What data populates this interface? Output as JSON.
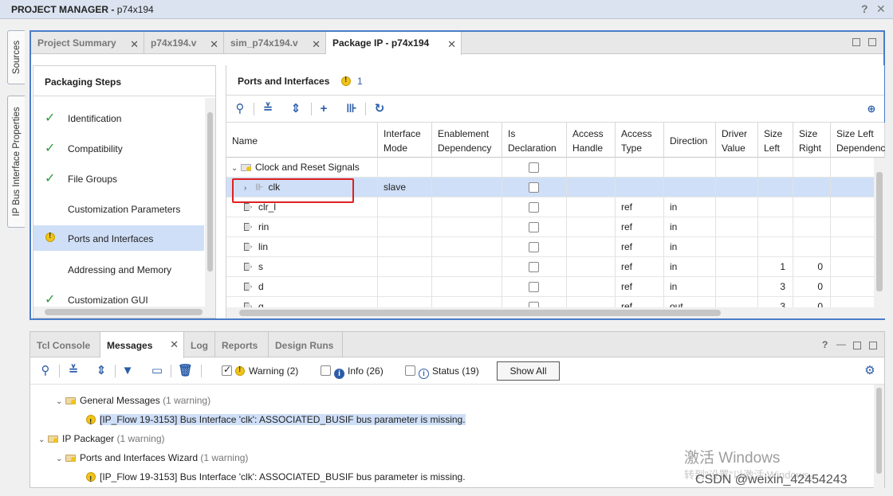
{
  "title_bar": {
    "label": "PROJECT MANAGER",
    "project": "p74x194",
    "help": "?",
    "close": "✕"
  },
  "side_tabs": [
    "Sources",
    "IP Bus Interface Properties"
  ],
  "editor_tabs": [
    {
      "label": "Project Summary",
      "close": "✕"
    },
    {
      "label": "p74x194.v",
      "close": "✕"
    },
    {
      "label": "sim_p74x194.v",
      "close": "✕"
    },
    {
      "label": "Package IP - p74x194",
      "close": "✕"
    }
  ],
  "steps": {
    "header": "Packaging Steps",
    "items": [
      {
        "label": "Identification",
        "status": "✓"
      },
      {
        "label": "Compatibility",
        "status": "✓"
      },
      {
        "label": "File Groups",
        "status": "✓"
      },
      {
        "label": "Customization Parameters",
        "status": ""
      },
      {
        "label": "Ports and Interfaces",
        "status": "warning"
      },
      {
        "label": "Addressing and Memory",
        "status": ""
      },
      {
        "label": "Customization GUI",
        "status": "✓"
      }
    ]
  },
  "ports": {
    "header": "Ports and Interfaces",
    "warning_count": "1",
    "columns": [
      "Name",
      "Interface Mode",
      "Enablement Dependency",
      "Is Declaration",
      "Access Handle",
      "Access Type",
      "Direction",
      "Driver Value",
      "Size Left",
      "Size Right",
      "Size Left Dependency"
    ],
    "rows": [
      {
        "name": "Clock and Reset Signals",
        "mode": "",
        "type": "",
        "direction": "",
        "size_left": "",
        "size_right": ""
      },
      {
        "name": "clk",
        "mode": "slave",
        "type": "",
        "direction": "",
        "size_left": "",
        "size_right": ""
      },
      {
        "name": "clr_l",
        "mode": "",
        "type": "ref",
        "direction": "in",
        "size_left": "",
        "size_right": ""
      },
      {
        "name": "rin",
        "mode": "",
        "type": "ref",
        "direction": "in",
        "size_left": "",
        "size_right": ""
      },
      {
        "name": "lin",
        "mode": "",
        "type": "ref",
        "direction": "in",
        "size_left": "",
        "size_right": ""
      },
      {
        "name": "s",
        "mode": "",
        "type": "ref",
        "direction": "in",
        "size_left": "1",
        "size_right": "0"
      },
      {
        "name": "d",
        "mode": "",
        "type": "ref",
        "direction": "in",
        "size_left": "3",
        "size_right": "0"
      },
      {
        "name": "q",
        "mode": "",
        "type": "ref",
        "direction": "out",
        "size_left": "3",
        "size_right": "0"
      }
    ]
  },
  "messages": {
    "tabs": [
      {
        "label": "Tcl Console"
      },
      {
        "label": "Messages",
        "close": "✕"
      },
      {
        "label": "Log"
      },
      {
        "label": "Reports"
      },
      {
        "label": "Design Runs"
      }
    ],
    "filters": {
      "warning": "Warning (2)",
      "info": "Info (26)",
      "status": "Status (19)",
      "show_all": "Show All"
    },
    "tree": [
      {
        "text": "General Messages",
        "count": "(1 warning)"
      },
      {
        "text": "[IP_Flow 19-3153] Bus Interface 'clk': ASSOCIATED_BUSIF bus parameter is missing."
      },
      {
        "text": "IP Packager",
        "count": "(1 warning)"
      },
      {
        "text": "Ports and Interfaces Wizard",
        "count": "(1 warning)"
      },
      {
        "text": "[IP_Flow 19-3153] Bus Interface 'clk': ASSOCIATED_BUSIF bus parameter is missing."
      }
    ]
  },
  "watermark": {
    "line1": "激活 Windows",
    "line2": "转到\"设置\"以激活 Windows。",
    "credit": "CSDN @weixin_42454243"
  }
}
